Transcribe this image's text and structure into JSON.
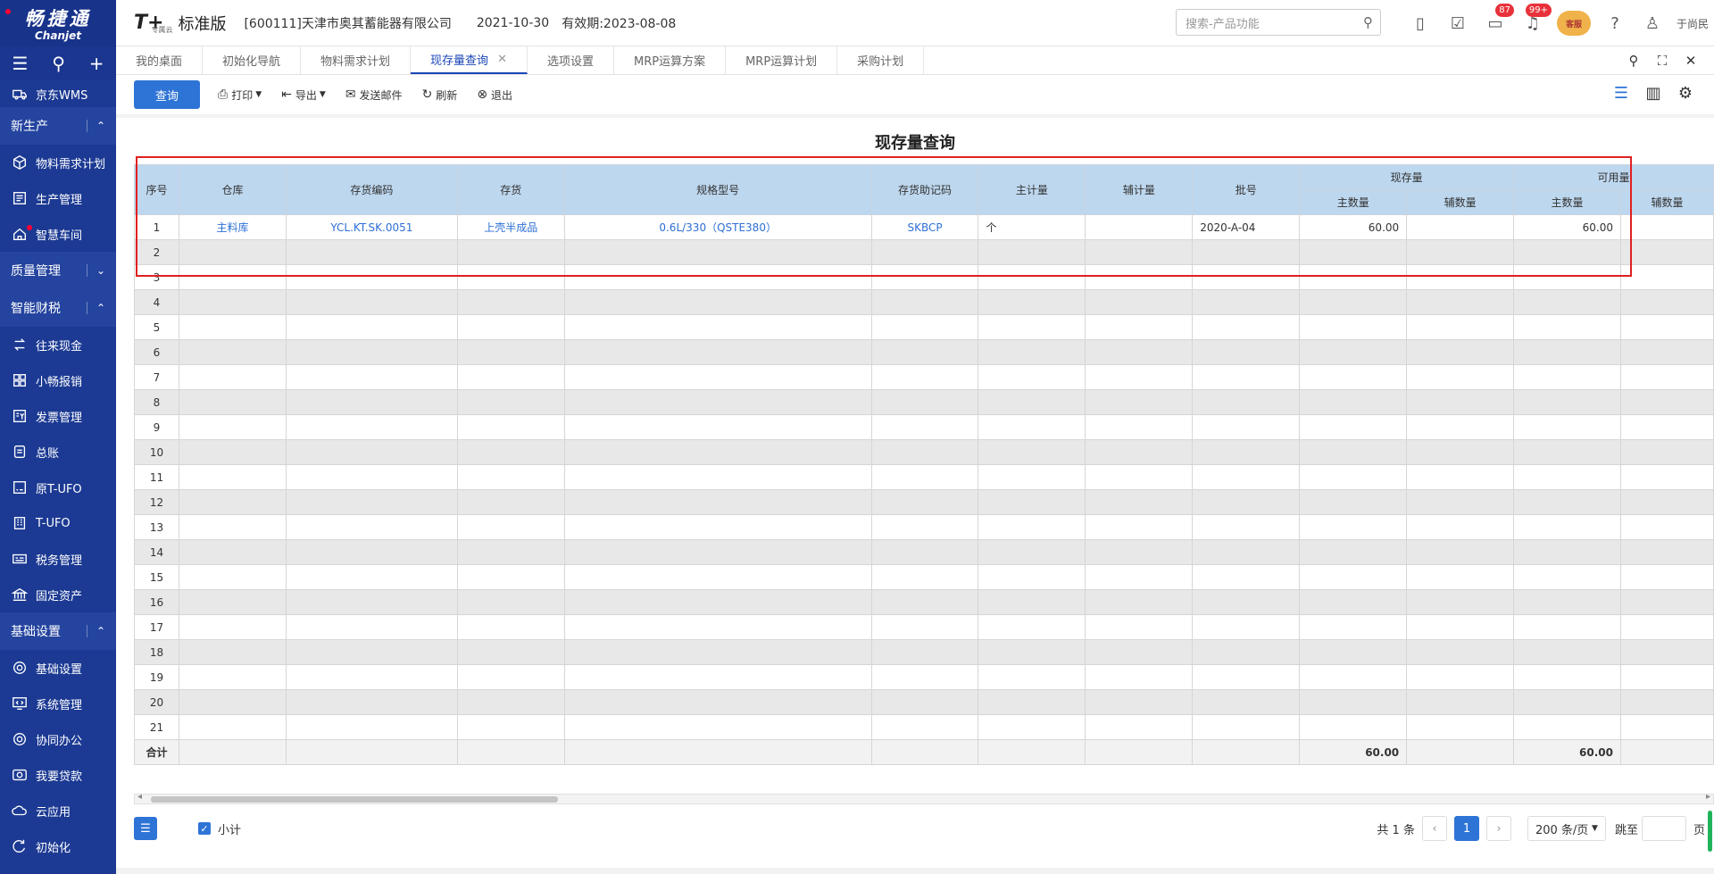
{
  "sidebar": {
    "logo_cn": "畅捷通",
    "logo_en": "Chanjet",
    "items": [
      {
        "type": "item",
        "label": "京东WMS",
        "icon": "truck-icon",
        "partial": true
      },
      {
        "type": "group",
        "label": "新生产",
        "chev": "⌃",
        "dot": true
      },
      {
        "type": "item",
        "label": "物料需求计划",
        "icon": "cube-icon"
      },
      {
        "type": "item",
        "label": "生产管理",
        "icon": "list-icon"
      },
      {
        "type": "item",
        "label": "智慧车间",
        "icon": "home-icon",
        "dot": true
      },
      {
        "type": "group",
        "label": "质量管理",
        "chev": "⌄"
      },
      {
        "type": "group",
        "label": "智能财税",
        "chev": "⌃"
      },
      {
        "type": "item",
        "label": "往来现金",
        "icon": "exchange-icon"
      },
      {
        "type": "item",
        "label": "小畅报销",
        "icon": "grid-icon"
      },
      {
        "type": "item",
        "label": "发票管理",
        "icon": "invoice-icon"
      },
      {
        "type": "item",
        "label": "总账",
        "icon": "ledger-icon"
      },
      {
        "type": "item",
        "label": "原T-UFO",
        "icon": "ufo-icon"
      },
      {
        "type": "item",
        "label": "T-UFO",
        "icon": "building-icon"
      },
      {
        "type": "item",
        "label": "税务管理",
        "icon": "tax-icon"
      },
      {
        "type": "item",
        "label": "固定资产",
        "icon": "bank-icon"
      },
      {
        "type": "group",
        "label": "基础设置",
        "chev": "⌃"
      },
      {
        "type": "item",
        "label": "基础设置",
        "icon": "settings-icon"
      },
      {
        "type": "item",
        "label": "系统管理",
        "icon": "code-icon"
      },
      {
        "type": "item",
        "label": "协同办公",
        "icon": "sync-icon"
      },
      {
        "type": "item",
        "label": "我要贷款",
        "icon": "loan-icon"
      },
      {
        "type": "item",
        "label": "云应用",
        "icon": "cloud-icon"
      },
      {
        "type": "item",
        "label": "初始化",
        "icon": "init-icon"
      }
    ]
  },
  "header": {
    "brand": "T+",
    "brand_sub": "专属云",
    "edition": "标准版",
    "company": "[600111]天津市奥其蓄能器有限公司",
    "date": "2021-10-30",
    "valid": "有效期:2023-08-08",
    "search_placeholder": "搜索-产品功能",
    "badge_msg": "87",
    "badge_notice": "99+",
    "avatar_text": "客服",
    "user": "于尚民"
  },
  "tabs": [
    {
      "label": "我的桌面",
      "active": false
    },
    {
      "label": "初始化导航",
      "active": false
    },
    {
      "label": "物料需求计划",
      "active": false
    },
    {
      "label": "现存量查询",
      "active": true
    },
    {
      "label": "选项设置",
      "active": false
    },
    {
      "label": "MRP运算方案",
      "active": false
    },
    {
      "label": "MRP运算计划",
      "active": false
    },
    {
      "label": "采购计划",
      "active": false
    }
  ],
  "toolbar": {
    "query": "查询",
    "print": "打印",
    "export": "导出",
    "email": "发送邮件",
    "refresh": "刷新",
    "exit": "退出"
  },
  "page_title": "现存量查询",
  "table": {
    "headers": {
      "seq": "序号",
      "warehouse": "仓库",
      "code": "存货编码",
      "item": "存货",
      "spec": "规格型号",
      "mnemonic": "存货助记码",
      "main_unit": "主计量",
      "aux_unit": "辅计量",
      "batch": "批号",
      "onhand": "现存量",
      "available": "可用量",
      "main_qty": "主数量",
      "aux_qty": "辅数量"
    },
    "rows": [
      {
        "seq": "1",
        "warehouse": "主料库",
        "code": "YCL.KT.SK.0051",
        "item": "上壳半成品",
        "spec": "0.6L/330（QSTE380）",
        "mnemonic": "SKBCP",
        "main_unit": "个",
        "aux_unit": "",
        "batch": "2020-A-04",
        "onhand_main": "60.00",
        "onhand_aux": "",
        "avail_main": "60.00",
        "avail_aux": ""
      }
    ],
    "empty_rows": [
      "2",
      "3",
      "4",
      "5",
      "6",
      "7",
      "8",
      "9",
      "10",
      "11",
      "12",
      "13",
      "14",
      "15",
      "16",
      "17",
      "18",
      "19",
      "20",
      "21"
    ],
    "total_label": "合计",
    "total_onhand_main": "60.00",
    "total_avail_main": "60.00"
  },
  "footer": {
    "subtotal": "小计",
    "count": "共 1 条",
    "prev": "‹",
    "page": "1",
    "next": "›",
    "page_size": "200 条/页",
    "jump": "跳至",
    "page_unit": "页"
  }
}
